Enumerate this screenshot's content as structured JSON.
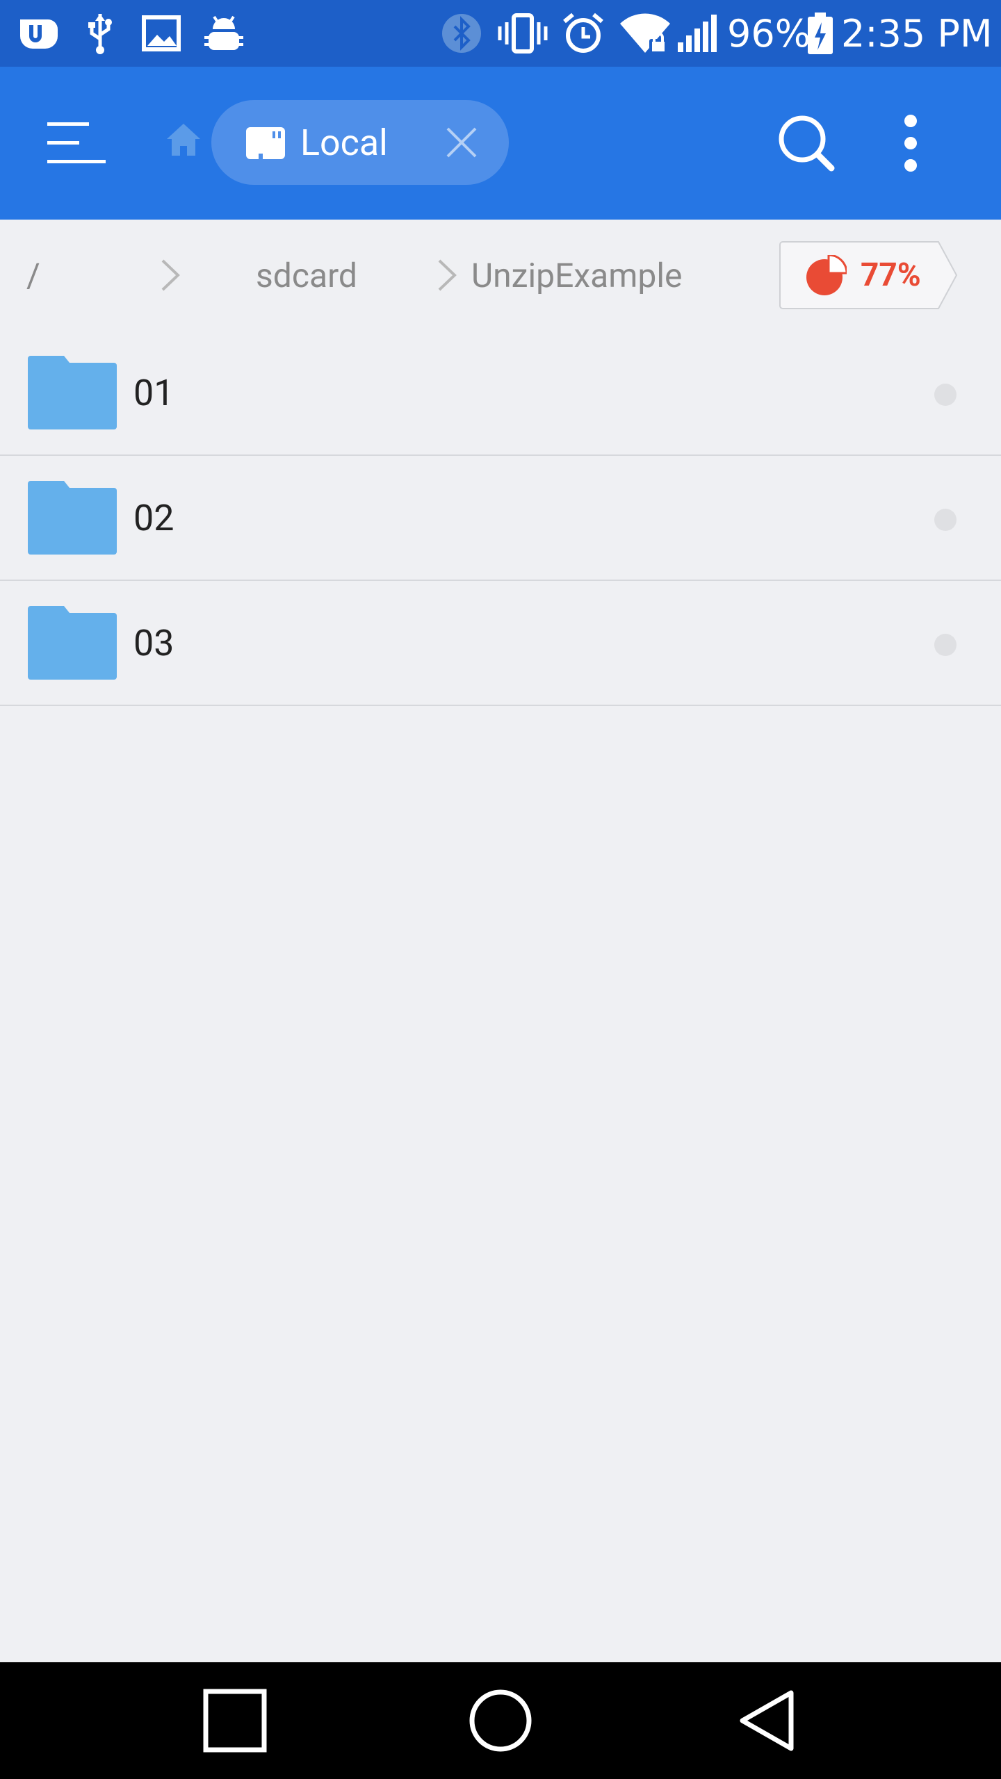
{
  "status_bar": {
    "battery": "96%",
    "time": "2:35 PM",
    "icons": [
      "uc-browser-icon",
      "usb-icon",
      "image-icon",
      "android-debug-icon",
      "bluetooth-icon",
      "vibrate-icon",
      "alarm-icon",
      "wifi-locked-icon",
      "signal-icon",
      "battery-charging-icon"
    ]
  },
  "app_bar": {
    "tab_label": "Local",
    "icons": [
      "menu-icon",
      "home-icon",
      "sd-card-icon",
      "close-icon",
      "search-icon",
      "more-vert-icon"
    ]
  },
  "breadcrumb": {
    "items": [
      "/",
      "sdcard",
      "UnzipExample"
    ],
    "usage_percent": "77%",
    "usage_value": 0.77,
    "usage_color": "#e94b35"
  },
  "files": [
    {
      "name": "01",
      "type": "folder"
    },
    {
      "name": "02",
      "type": "folder"
    },
    {
      "name": "03",
      "type": "folder"
    }
  ],
  "colors": {
    "status_bar": "#1d5fc8",
    "app_bar": "#2676e4",
    "folder": "#64b0eb",
    "background": "#eff0f3"
  },
  "nav_bar": {
    "icons": [
      "recent-apps-icon",
      "home-circle-icon",
      "back-icon"
    ]
  }
}
